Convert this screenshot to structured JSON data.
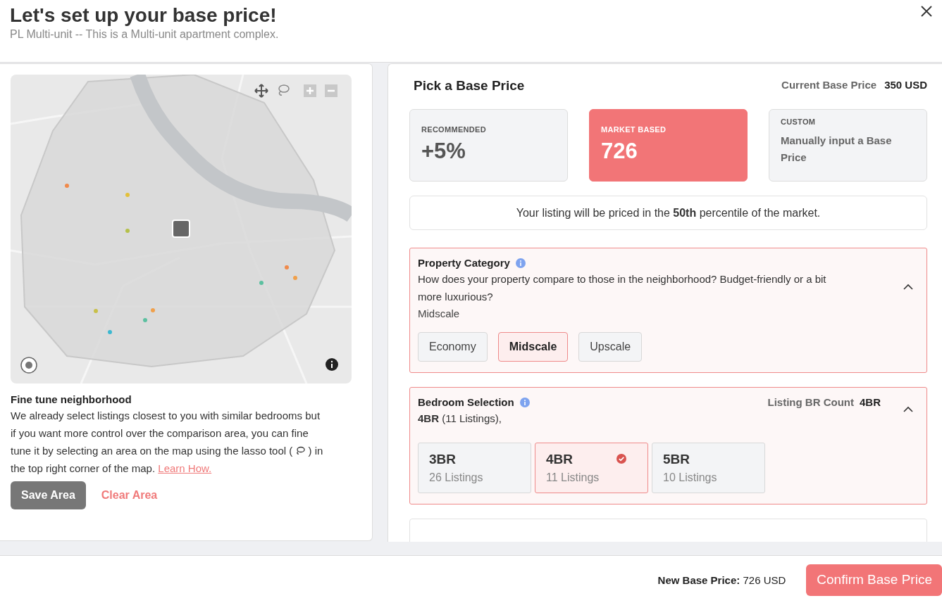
{
  "dialog": {
    "title": "Let's set up your base price!",
    "subtitle": "PL Multi-unit -- This is a Multi-unit apartment complex."
  },
  "map": {
    "section_title": "Fine tune neighborhood",
    "description_before": "We already select listings closest to you with similar bedrooms but if you want more control over the comparison area, you can fine tune it by selecting an area on the map using the lasso tool (",
    "description_after": ") in the top right corner of the map.",
    "learn_link": "Learn How.",
    "buttons": [
      {
        "label": "Save Area",
        "kind": "filled"
      },
      {
        "label": "Clear Area",
        "kind": "text"
      }
    ]
  },
  "pricing": {
    "title": "Pick a Base Price",
    "current_label": "Current Base Price",
    "current_value": "350 USD",
    "options": [
      {
        "label": "RECOMMENDED",
        "value": "+5%",
        "kind": "figure",
        "selected": false
      },
      {
        "label": "MARKET BASED",
        "value": "726",
        "kind": "figure",
        "selected": true
      },
      {
        "label": "CUSTOM",
        "value": "Manually input a Base Price",
        "kind": "text",
        "selected": false
      }
    ],
    "percentile_note": "Your listing will be priced in the **50th** percentile of the market."
  },
  "property_category": {
    "title": "Property Category",
    "question": "How does your property compare to those in the neighborhood? Budget-friendly or a bit more luxurious?",
    "current": "Midscale",
    "expanded": true,
    "options": [
      {
        "label": "Economy",
        "selected": false
      },
      {
        "label": "Midscale",
        "selected": true
      },
      {
        "label": "Upscale",
        "selected": false
      }
    ]
  },
  "bedroom_selection": {
    "title": "Bedroom Selection",
    "count_label": "Listing BR Count",
    "count_value": "4BR",
    "summary": "**4BR** (11 Listings),",
    "expanded": true,
    "options": [
      {
        "label": "3BR",
        "listings": "26 Listings",
        "selected": false
      },
      {
        "label": "4BR",
        "listings": "11 Listings",
        "selected": true
      },
      {
        "label": "5BR",
        "listings": "10 Listings",
        "selected": false
      }
    ]
  },
  "footer": {
    "new_price_label": "New Base Price:",
    "new_price_value": "726 USD",
    "confirm": "Confirm Base Price"
  }
}
